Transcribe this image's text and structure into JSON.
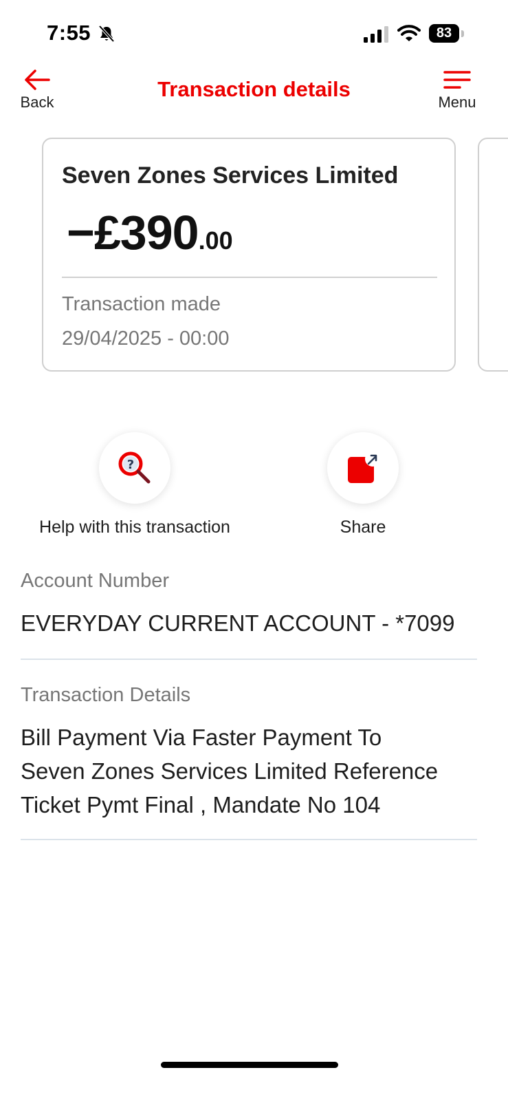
{
  "status_bar": {
    "time": "7:55",
    "battery": "83"
  },
  "header": {
    "back_label": "Back",
    "title": "Transaction details",
    "menu_label": "Menu"
  },
  "card": {
    "merchant": "Seven Zones Services Limited",
    "amount_main": "−£390",
    "amount_decimal": ".00",
    "made_label": "Transaction made",
    "made_value": "29/04/2025 - 00:00"
  },
  "actions": {
    "help_label": "Help with this transaction",
    "share_label": "Share"
  },
  "details": {
    "account_label": "Account Number",
    "account_value": "EVERYDAY CURRENT ACCOUNT - *7099",
    "transaction_label": "Transaction Details",
    "transaction_line1": "Bill Payment Via Faster Payment To",
    "transaction_line2": "Seven Zones Services Limited Reference",
    "transaction_line3": "Ticket Pymt Final , Mandate No 104"
  },
  "colors": {
    "brand_red": "#ec0000",
    "muted_text": "#767676"
  },
  "icons": [
    "bell-slash-icon",
    "signal-icon",
    "wifi-icon",
    "battery-icon",
    "back-arrow-icon",
    "menu-icon",
    "help-search-icon",
    "share-icon"
  ]
}
